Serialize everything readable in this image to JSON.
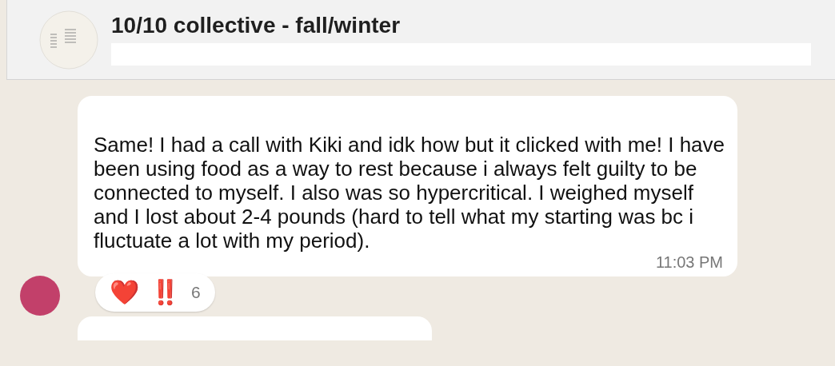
{
  "chat": {
    "title": "10/10 collective - fall/winter"
  },
  "messages": [
    {
      "text": "Same! I had a call with Kiki and idk how but it clicked with me! I have been using food as a way to rest because i always felt guilty to be connected to myself. I also was so hypercritical. I weighed myself and I lost about 2-4 pounds (hard to tell what my starting was bc i fluctuate a lot with my period).",
      "time": "11:03 PM",
      "reactions": {
        "emoji": [
          "❤️",
          "‼️"
        ],
        "count": "6"
      }
    }
  ]
}
